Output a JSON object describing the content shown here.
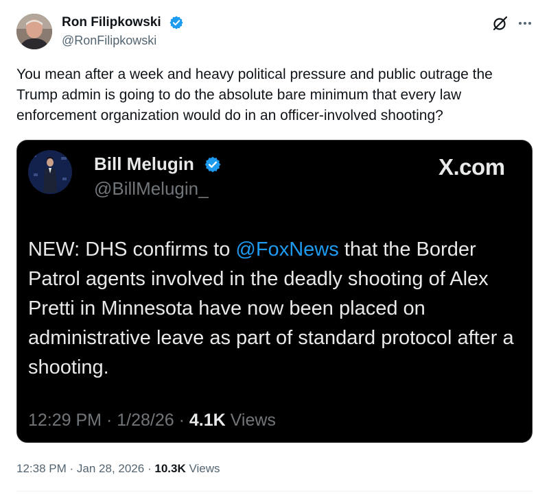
{
  "post": {
    "author": {
      "name": "Ron Filipkowski",
      "handle": "@RonFilipkowski",
      "verified": true
    },
    "text": "You mean after a week and heavy political pressure and public outrage the Trump admin is going to do the absolute bare minimum that every law enforcement organization would do in an officer-involved shooting?",
    "time": "12:38 PM",
    "date": "Jan 28, 2026",
    "views_count": "10.3K",
    "views_label": "Views",
    "separator": "·",
    "icons": {
      "grok": "grok-icon",
      "more": "more-icon",
      "verified": "verified-badge-icon"
    }
  },
  "quote": {
    "author": {
      "name": "Bill Melugin",
      "handle": "@BillMelugin_",
      "verified": true
    },
    "source": "X.com",
    "text_before": "NEW: DHS confirms to ",
    "mention": "@FoxNews",
    "text_after": " that the Border Patrol agents involved in the deadly shooting of Alex Pretti in Minnesota have now been placed on administrative leave as part of standard protocol after a shooting.",
    "time": "12:29 PM",
    "date": "1/28/26",
    "views_count": "4.1K",
    "views_label": "Views",
    "separator": "·"
  },
  "colors": {
    "verified": "#1d9bf0",
    "mention": "#1d9bf0",
    "quote_background": "#000000",
    "secondary_text": "#536471"
  }
}
